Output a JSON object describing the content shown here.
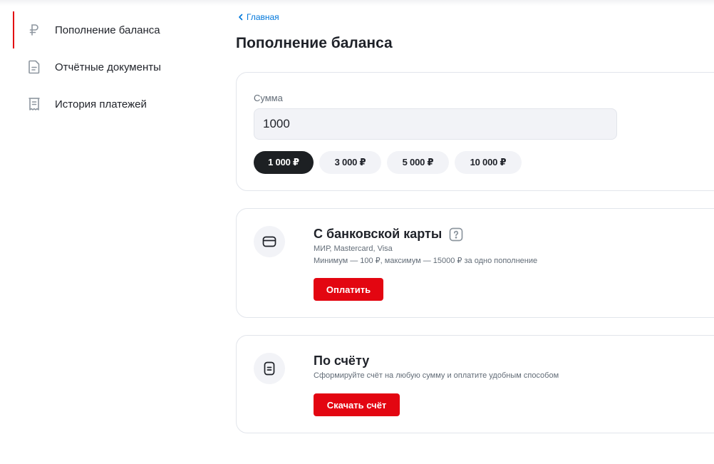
{
  "sidebar": {
    "items": [
      {
        "label": "Пополнение баланса",
        "icon": "ruble-icon",
        "active": true
      },
      {
        "label": "Отчётные документы",
        "icon": "document-icon",
        "active": false
      },
      {
        "label": "История платежей",
        "icon": "receipt-icon",
        "active": false
      }
    ]
  },
  "breadcrumb": {
    "label": "Главная"
  },
  "page": {
    "title": "Пополнение баланса"
  },
  "amount": {
    "label": "Сумма",
    "value": "1000",
    "presets": [
      "1 000 ₽",
      "3 000 ₽",
      "5 000 ₽",
      "10 000 ₽"
    ],
    "selected_preset": 0
  },
  "card_payment": {
    "title": "С банковской карты",
    "systems": "МИР, Mastercard, Visa",
    "limits": "Минимум — 100 ₽, максимум — 15000 ₽ за одно пополнение",
    "button": "Оплатить",
    "icon": "card-icon"
  },
  "invoice_payment": {
    "title": "По счёту",
    "description": "Сформируйте счёт на любую сумму и оплатите удобным способом",
    "button": "Скачать счёт",
    "icon": "invoice-icon"
  },
  "colors": {
    "accent": "#e30611",
    "link": "#0077db",
    "text": "#1f2229",
    "muted": "#626c77"
  }
}
